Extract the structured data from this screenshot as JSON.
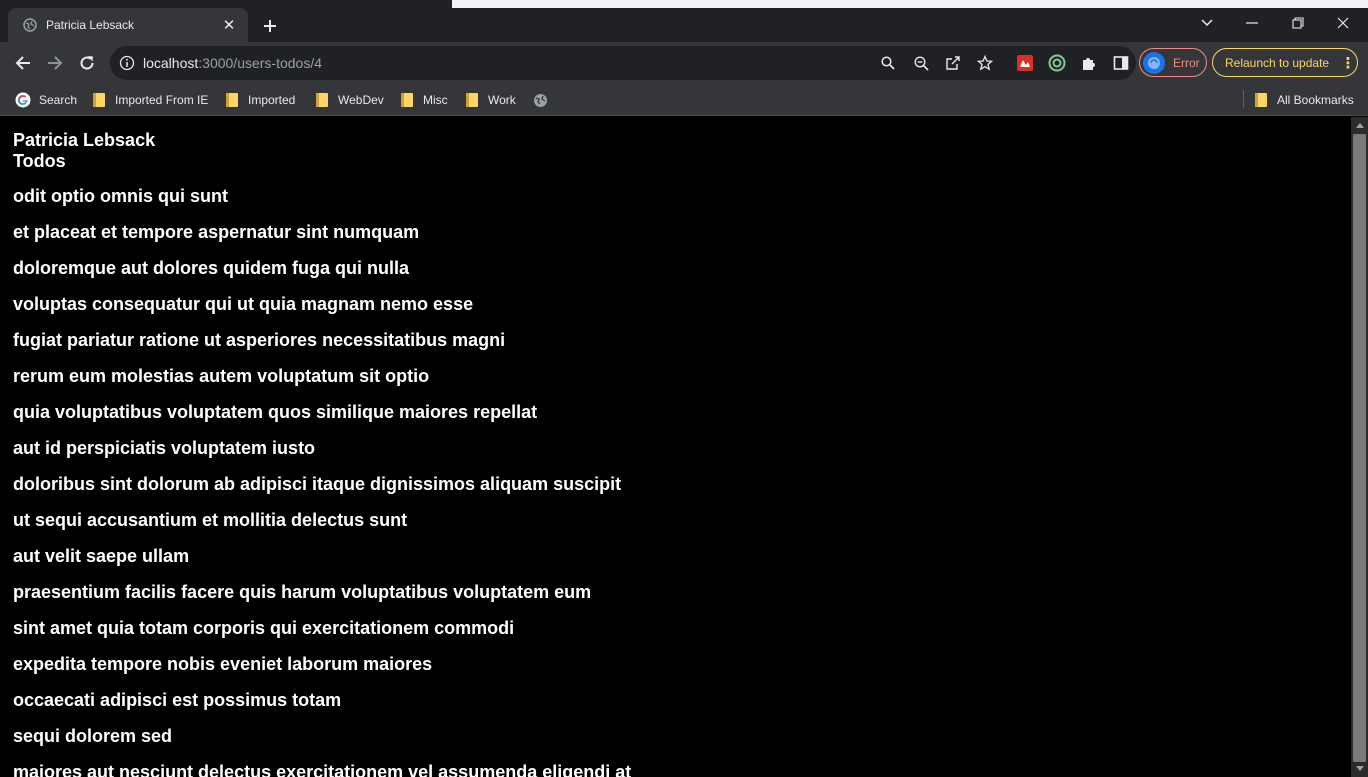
{
  "browser": {
    "tab": {
      "title": "Patricia Lebsack"
    },
    "address": {
      "host": "localhost",
      "path": ":3000/users-todos/4"
    },
    "profile": {
      "status_label": "Error"
    },
    "update_button": {
      "label": "Relaunch to update"
    },
    "bookmarks": [
      {
        "label": "Search",
        "icon": "google-icon"
      },
      {
        "label": "Imported From IE",
        "icon": "folder-icon"
      },
      {
        "label": "Imported",
        "icon": "folder-icon"
      },
      {
        "label": "WebDev",
        "icon": "folder-icon"
      },
      {
        "label": "Misc",
        "icon": "folder-icon"
      },
      {
        "label": "Work",
        "icon": "folder-icon"
      }
    ],
    "all_bookmarks": {
      "label": "All Bookmarks"
    }
  },
  "page": {
    "user_name": "Patricia Lebsack",
    "todos_heading": "Todos",
    "todos": [
      "odit optio omnis qui sunt",
      "et placeat et tempore aspernatur sint numquam",
      "doloremque aut dolores quidem fuga qui nulla",
      "voluptas consequatur qui ut quia magnam nemo esse",
      "fugiat pariatur ratione ut asperiores necessitatibus magni",
      "rerum eum molestias autem voluptatum sit optio",
      "quia voluptatibus voluptatem quos similique maiores repellat",
      "aut id perspiciatis voluptatem iusto",
      "doloribus sint dolorum ab adipisci itaque dignissimos aliquam suscipit",
      "ut sequi accusantium et mollitia delectus sunt",
      "aut velit saepe ullam",
      "praesentium facilis facere quis harum voluptatibus voluptatem eum",
      "sint amet quia totam corporis qui exercitationem commodi",
      "expedita tempore nobis eveniet laborum maiores",
      "occaecati adipisci est possimus totam",
      "sequi dolorem sed",
      "maiores aut nesciunt delectus exercitationem vel assumenda eligendi at"
    ]
  },
  "colors": {
    "page_bg": "#000000",
    "chrome_bg": "#35363a",
    "tabstrip_bg": "#202124",
    "error_accent": "#f28b82",
    "update_accent": "#fdd663"
  }
}
